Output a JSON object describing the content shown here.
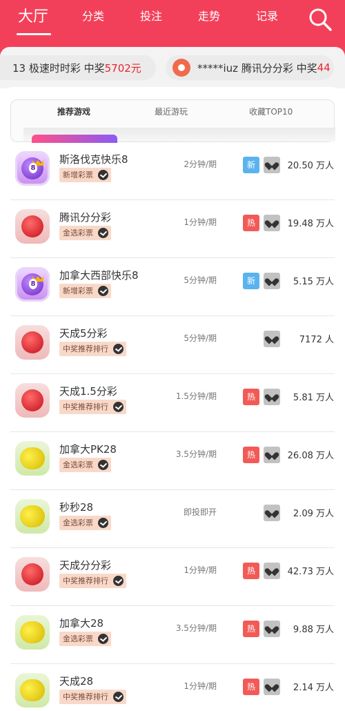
{
  "nav": {
    "items": [
      {
        "label": "大厅"
      },
      {
        "label": "分类"
      },
      {
        "label": "投注"
      },
      {
        "label": "走势"
      },
      {
        "label": "记录"
      }
    ]
  },
  "ticker": {
    "item1": {
      "text": "13 极速时时彩 中奖",
      "amount": "5702元"
    },
    "item2": {
      "text": "*****iuz 腾讯分分彩 中奖",
      "amount": "44"
    }
  },
  "tabs": [
    {
      "label": "推荐游戏"
    },
    {
      "label": "最近游玩"
    },
    {
      "label": "收藏TOP10"
    }
  ],
  "games": [
    {
      "name": "斯洛伐克快乐8",
      "tag": "新增彩票",
      "period": "2分钟/期",
      "badge": "新",
      "players": "20.50 万人",
      "icon": "purple-8-ball-icon"
    },
    {
      "name": "腾讯分分彩",
      "tag": "金选彩票",
      "period": "1分钟/期",
      "badge": "热",
      "players": "19.48 万人",
      "icon": "red-ball-icon"
    },
    {
      "name": "加拿大西部快乐8",
      "tag": "新增彩票",
      "period": "5分钟/期",
      "badge": "新",
      "players": "5.15 万人",
      "icon": "purple-8-ball-icon"
    },
    {
      "name": "天成5分彩",
      "tag": "中奖推荐排行",
      "period": "5分钟/期",
      "badge": "",
      "players": "7172 人",
      "icon": "red-ball-icon"
    },
    {
      "name": "天成1.5分彩",
      "tag": "中奖推荐排行",
      "period": "1.5分钟/期",
      "badge": "热",
      "players": "5.81 万人",
      "icon": "red-ball-icon"
    },
    {
      "name": "加拿大PK28",
      "tag": "金选彩票",
      "period": "3.5分钟/期",
      "badge": "热",
      "players": "26.08 万人",
      "icon": "yellow-balls-icon"
    },
    {
      "name": "秒秒28",
      "tag": "金选彩票",
      "period": "即投即开",
      "badge": "",
      "players": "2.09 万人",
      "icon": "yellow-balls-icon"
    },
    {
      "name": "天成分分彩",
      "tag": "中奖推荐排行",
      "period": "1分钟/期",
      "badge": "热",
      "players": "42.73 万人",
      "icon": "red-ball-icon"
    },
    {
      "name": "加拿大28",
      "tag": "金选彩票",
      "period": "3.5分钟/期",
      "badge": "热",
      "players": "9.88 万人",
      "icon": "yellow-balls-icon"
    },
    {
      "name": "天成28",
      "tag": "中奖推荐排行",
      "period": "1分钟/期",
      "badge": "热",
      "players": "2.14 万人",
      "icon": "yellow-balls-icon"
    }
  ],
  "colors": {
    "brand": "#f3405a",
    "hot": "#f25a56",
    "new": "#5ab3ee",
    "win_amount": "#e8242f"
  }
}
